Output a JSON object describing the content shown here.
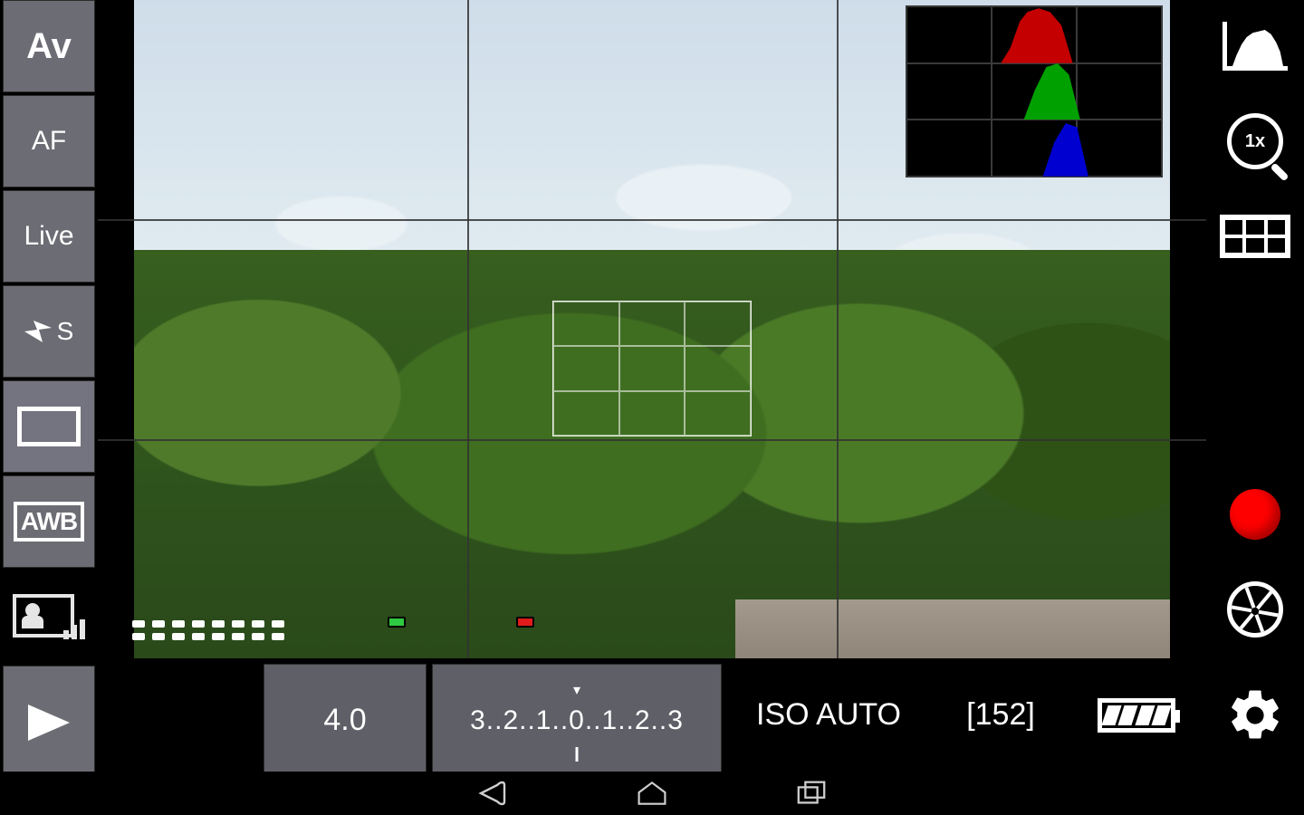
{
  "left_rail": {
    "mode": {
      "label": "Av"
    },
    "af": {
      "label": "AF"
    },
    "live": {
      "label": "Live"
    },
    "flash": {
      "label": "S"
    },
    "awb": {
      "label": "AWB"
    }
  },
  "right_rail": {
    "zoom": {
      "label": "1x"
    }
  },
  "status": {
    "aperture": "4.0",
    "ev_scale": "3..2..1..0..1..2..3",
    "iso": "ISO AUTO",
    "shots": "[152]"
  },
  "histogram": {
    "channels": [
      "red",
      "green",
      "blue"
    ]
  },
  "icons": {
    "flash": "flash-icon",
    "frame": "single-frame-icon",
    "awb": "white-balance-icon",
    "picstyle": "picture-style-icon",
    "play": "play-icon",
    "hist": "histogram-icon",
    "zoom": "zoom-icon",
    "grid": "grid-icon",
    "record": "record-icon",
    "aperture": "aperture-icon",
    "gear": "gear-icon",
    "battery": "battery-icon",
    "nav_back": "nav-back-icon",
    "nav_home": "nav-home-icon",
    "nav_recent": "nav-recent-icon"
  }
}
